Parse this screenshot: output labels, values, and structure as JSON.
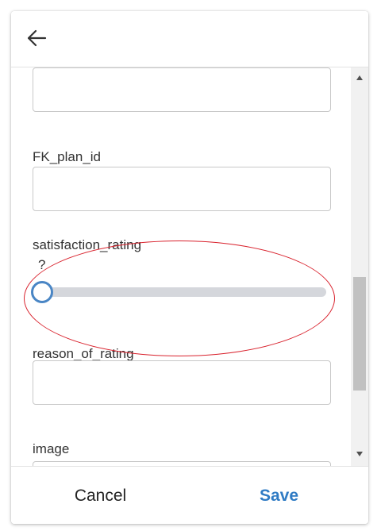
{
  "dialog": {
    "back_icon": "arrow-left-icon"
  },
  "form": {
    "fields": [
      {
        "label": "",
        "value": ""
      },
      {
        "label": "FK_plan_id",
        "value": ""
      },
      {
        "label": "satisfaction_rating",
        "value": "?"
      },
      {
        "label": "reason_of_rating",
        "value": ""
      },
      {
        "label": "image",
        "value": ""
      }
    ],
    "slider": {
      "value_text": "?",
      "level": 0,
      "thumb_color": "#4a86c5",
      "track_color": "#d5d7dc"
    }
  },
  "annotation": {
    "shape": "ellipse",
    "color": "#d9232e"
  },
  "footer": {
    "cancel_label": "Cancel",
    "save_label": "Save",
    "save_color": "#2f7bc4"
  }
}
